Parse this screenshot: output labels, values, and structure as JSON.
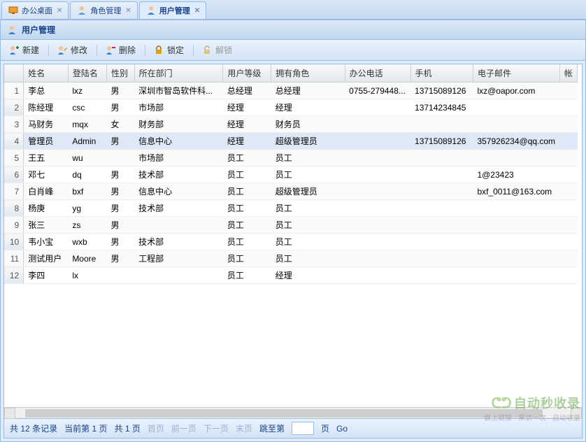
{
  "tabs": [
    {
      "label": "办公桌面",
      "icon": "desktop",
      "closable": true,
      "active": false
    },
    {
      "label": "角色管理",
      "icon": "user",
      "closable": true,
      "active": false
    },
    {
      "label": "用户管理",
      "icon": "user-blue",
      "closable": true,
      "active": true
    }
  ],
  "panel": {
    "title": "用户管理"
  },
  "toolbar": {
    "new": "新建",
    "edit": "修改",
    "delete": "删除",
    "lock": "锁定",
    "unlock": "解锁"
  },
  "columns": [
    "",
    "姓名",
    "登陆名",
    "性别",
    "所在部门",
    "用户等级",
    "拥有角色",
    "办公电话",
    "手机",
    "电子邮件",
    "帐"
  ],
  "rows": [
    {
      "n": 1,
      "name": "李总",
      "login": "lxz",
      "sex": "男",
      "dept": "深圳市智岛软件科...",
      "level": "总经理",
      "role": "总经理",
      "tel": "0755-279448...",
      "mobile": "13715089126",
      "email": "lxz@oapor.com"
    },
    {
      "n": 2,
      "name": "陈经理",
      "login": "csc",
      "sex": "男",
      "dept": "市场部",
      "level": "经理",
      "role": "经理",
      "tel": "",
      "mobile": "13714234845",
      "email": ""
    },
    {
      "n": 3,
      "name": "马财务",
      "login": "mqx",
      "sex": "女",
      "dept": "财务部",
      "level": "经理",
      "role": "财务员",
      "tel": "",
      "mobile": "",
      "email": ""
    },
    {
      "n": 4,
      "name": "管理员",
      "login": "Admin",
      "sex": "男",
      "dept": "信息中心",
      "level": "经理",
      "role": "超级管理员",
      "tel": "",
      "mobile": "13715089126",
      "email": "357926234@qq.com",
      "selected": true
    },
    {
      "n": 5,
      "name": "王五",
      "login": "wu",
      "sex": "",
      "dept": "市场部",
      "level": "员工",
      "role": "员工",
      "tel": "",
      "mobile": "",
      "email": ""
    },
    {
      "n": 6,
      "name": "邓七",
      "login": "dq",
      "sex": "男",
      "dept": "技术部",
      "level": "员工",
      "role": "员工",
      "tel": "",
      "mobile": "",
      "email": "1@23423"
    },
    {
      "n": 7,
      "name": "白肖峰",
      "login": "bxf",
      "sex": "男",
      "dept": "信息中心",
      "level": "员工",
      "role": "超级管理员",
      "tel": "",
      "mobile": "",
      "email": "bxf_0011@163.com"
    },
    {
      "n": 8,
      "name": "杨庚",
      "login": "yg",
      "sex": "男",
      "dept": "技术部",
      "level": "员工",
      "role": "员工",
      "tel": "",
      "mobile": "",
      "email": ""
    },
    {
      "n": 9,
      "name": "张三",
      "login": "zs",
      "sex": "男",
      "dept": "",
      "level": "员工",
      "role": "员工",
      "tel": "",
      "mobile": "",
      "email": ""
    },
    {
      "n": 10,
      "name": "韦小宝",
      "login": "wxb",
      "sex": "男",
      "dept": "技术部",
      "level": "员工",
      "role": "员工",
      "tel": "",
      "mobile": "",
      "email": ""
    },
    {
      "n": 11,
      "name": "测试用户",
      "login": "Moore",
      "sex": "男",
      "dept": "工程部",
      "level": "员工",
      "role": "员工",
      "tel": "",
      "mobile": "",
      "email": ""
    },
    {
      "n": 12,
      "name": "李四",
      "login": "lx",
      "sex": "",
      "dept": "",
      "level": "员工",
      "role": "经理",
      "tel": "",
      "mobile": "",
      "email": ""
    }
  ],
  "pager": {
    "summary_prefix": "共",
    "total": "12",
    "summary_mid": "条记录",
    "current_prefix": "当前第",
    "current_page": "1",
    "page_word": "页",
    "total_prefix": "共",
    "total_pages": "1",
    "first": "首页",
    "prev": "前一页",
    "next": "下一页",
    "last": "末页",
    "jump": "跳至第",
    "jump_page_word": "页",
    "go": "Go",
    "jump_value": ""
  },
  "watermark": {
    "brand": "自动秒收录",
    "tagline": "做上链接 · 来访一次 · 自动收录"
  }
}
